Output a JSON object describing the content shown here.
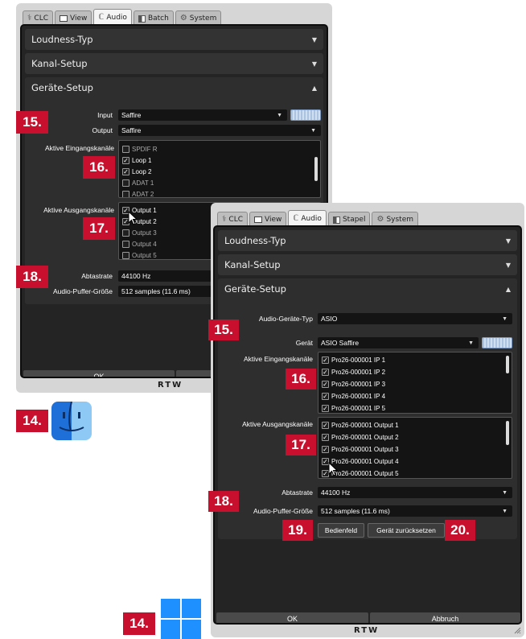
{
  "mac_window": {
    "tabs": [
      {
        "label": "CLC",
        "icon": "clc-icon"
      },
      {
        "label": "View",
        "icon": "view-icon"
      },
      {
        "label": "Audio",
        "icon": "audio-icon"
      },
      {
        "label": "Batch",
        "icon": "batch-icon"
      },
      {
        "label": "System",
        "icon": "system-icon"
      }
    ],
    "sections": {
      "loudness": "Loudness-Typ",
      "channel": "Kanal-Setup",
      "device": "Geräte-Setup"
    },
    "input_label": "Input",
    "input_value": "Saffire",
    "output_label": "Output",
    "output_value": "Saffire",
    "in_channels_label": "Aktive Eingangskanäle",
    "in_channels": [
      {
        "label": "SPDIF R",
        "checked": false
      },
      {
        "label": "Loop 1",
        "checked": true
      },
      {
        "label": "Loop 2",
        "checked": true
      },
      {
        "label": "ADAT 1",
        "checked": false
      },
      {
        "label": "ADAT 2",
        "checked": false
      }
    ],
    "out_channels_label": "Aktive Ausgangskanäle",
    "out_channels": [
      {
        "label": "Output 1",
        "checked": true
      },
      {
        "label": "Output 2",
        "checked": true
      },
      {
        "label": "Output 3",
        "checked": false
      },
      {
        "label": "Output 4",
        "checked": false
      },
      {
        "label": "Output 5",
        "checked": false
      }
    ],
    "samplerate_label": "Abtastrate",
    "samplerate_value": "44100 Hz",
    "buffer_label": "Audio-Puffer-Größe",
    "buffer_value": "512 samples (11.6 ms)",
    "ok_label": "OK",
    "brand": "RTW"
  },
  "win_window": {
    "tabs": [
      {
        "label": "CLC",
        "icon": "clc-icon"
      },
      {
        "label": "View",
        "icon": "view-icon"
      },
      {
        "label": "Audio",
        "icon": "audio-icon"
      },
      {
        "label": "Stapel",
        "icon": "batch-icon"
      },
      {
        "label": "System",
        "icon": "system-icon"
      }
    ],
    "sections": {
      "loudness": "Loudness-Typ",
      "channel": "Kanal-Setup",
      "device": "Geräte-Setup"
    },
    "device_type_label": "Audio-Geräte-Typ",
    "device_type_value": "ASIO",
    "device_label": "Gerät",
    "device_value": "ASIO Saffire",
    "in_channels_label": "Aktive Eingangskanäle",
    "in_channels": [
      {
        "label": "Pro26-000001 IP 1",
        "checked": true
      },
      {
        "label": "Pro26-000001 IP 2",
        "checked": true
      },
      {
        "label": "Pro26-000001 IP 3",
        "checked": true
      },
      {
        "label": "Pro26-000001 IP 4",
        "checked": true
      },
      {
        "label": "Pro26-000001 IP 5",
        "checked": true
      }
    ],
    "out_channels_label": "Aktive Ausgangskanäle",
    "out_channels": [
      {
        "label": "Pro26-000001 Output 1",
        "checked": true
      },
      {
        "label": "Pro26-000001 Output 2",
        "checked": true
      },
      {
        "label": "Pro26-000001 Output 3",
        "checked": true
      },
      {
        "label": "Pro26-000001 Output 4",
        "checked": true
      },
      {
        "label": "Pro26-000001 Output 5",
        "checked": true
      }
    ],
    "samplerate_label": "Abtastrate",
    "samplerate_value": "44100 Hz",
    "buffer_label": "Audio-Puffer-Größe",
    "buffer_value": "512 samples (11.6 ms)",
    "control_panel_label": "Bedienfeld",
    "reset_label": "Gerät zurücksetzen",
    "ok_label": "OK",
    "cancel_label": "Abbruch",
    "brand": "RTW"
  },
  "callouts": {
    "mac": {
      "n15": "15.",
      "n16": "16.",
      "n17": "17.",
      "n18": "18.",
      "n14": "14."
    },
    "win": {
      "n15": "15.",
      "n16": "16.",
      "n17": "17.",
      "n18": "18.",
      "n19": "19.",
      "n20": "20.",
      "n14": "14."
    }
  },
  "colors": {
    "callout": "#c8102e",
    "panel": "#242424",
    "window": "#d6d6d6"
  }
}
